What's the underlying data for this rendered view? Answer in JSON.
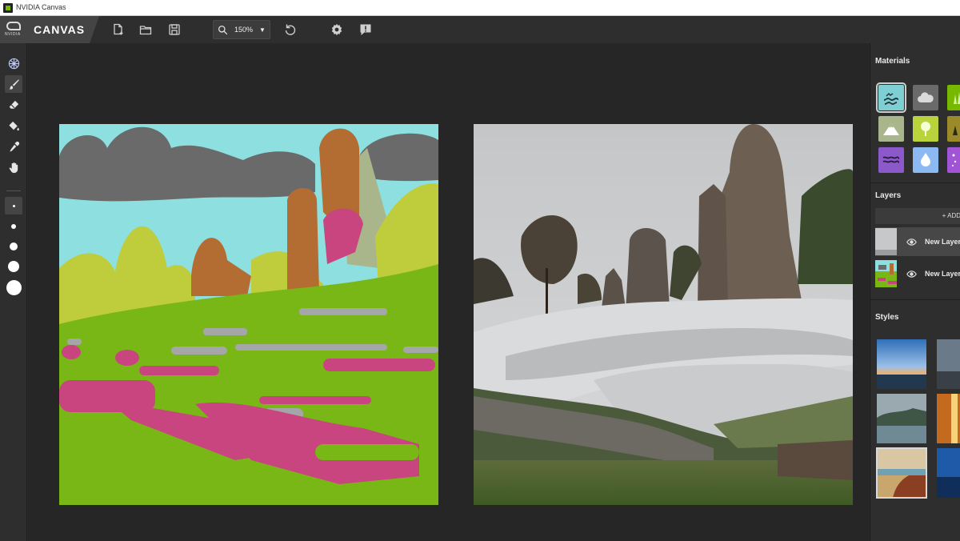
{
  "window": {
    "title": "NVIDIA Canvas"
  },
  "brand": {
    "logo_word": "NVIDIA",
    "app_name": "CANVAS"
  },
  "toolbar": {
    "zoom_value": "150%"
  },
  "panels": {
    "materials_title": "Materials",
    "layers_title": "Layers",
    "styles_title": "Styles",
    "add_layer_label": "+ ADD"
  },
  "layers": [
    {
      "name": "New Layer",
      "active": true
    },
    {
      "name": "New Layer",
      "active": false
    }
  ],
  "materials": [
    {
      "name": "water-icon",
      "color": "#7ecfd3"
    },
    {
      "name": "cloud-icon",
      "color": "#6a6a6a"
    },
    {
      "name": "grass-icon",
      "color": "#76b900"
    },
    {
      "name": "mountain-icon",
      "color": "#a9b58a"
    },
    {
      "name": "tree-icon",
      "color": "#b9d33d"
    },
    {
      "name": "bush-icon",
      "color": "#9a8a2a"
    },
    {
      "name": "waves-icon",
      "color": "#8b59c9"
    },
    {
      "name": "drop-icon",
      "color": "#8db9f2"
    },
    {
      "name": "sparkle-icon",
      "color": "#a155d6"
    }
  ],
  "colors": {
    "accent": "#76b900",
    "sky": "#8ddfe0",
    "clouds": "#6a6a6a",
    "rock": "#b36c32",
    "grass": "#78b715",
    "bush": "#bfcc3c",
    "flower": "#c9457f",
    "stone": "#a4a6a8"
  }
}
